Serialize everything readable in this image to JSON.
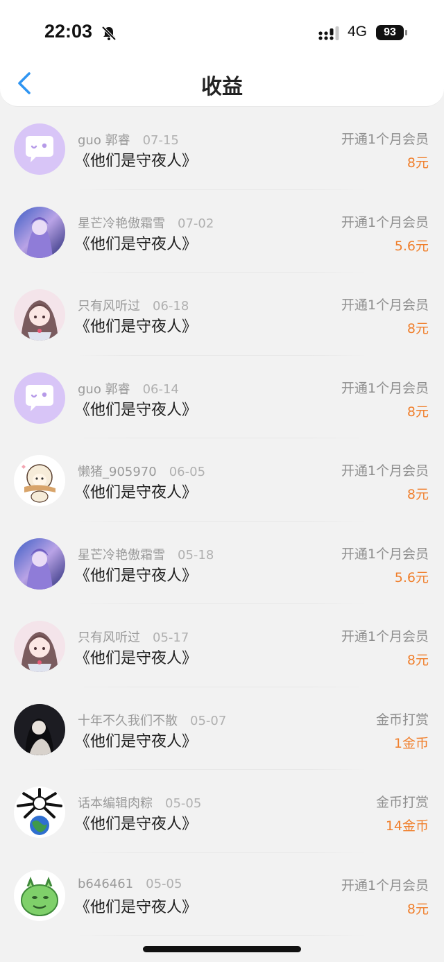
{
  "status_bar": {
    "time": "22:03",
    "network": "4G",
    "battery": "93"
  },
  "header": {
    "title": "收益",
    "back_icon": "chevron-left-icon",
    "accent": "#2f95f2"
  },
  "colors": {
    "amount": "#f07f2c",
    "background": "#f2f2f2"
  },
  "items": [
    {
      "user": "guo 郭睿",
      "date": "07-15",
      "work": "《他们是守夜人》",
      "type": "开通1个月会员",
      "amount": "8元",
      "avatar": "chat-bubble"
    },
    {
      "user": "星芒冷艳傲霜雪",
      "date": "07-02",
      "work": "《他们是守夜人》",
      "type": "开通1个月会员",
      "amount": "5.6元",
      "avatar": "anime-purple"
    },
    {
      "user": "只有风听过",
      "date": "06-18",
      "work": "《他们是守夜人》",
      "type": "开通1个月会员",
      "amount": "8元",
      "avatar": "anime-pink"
    },
    {
      "user": "guo 郭睿",
      "date": "06-14",
      "work": "《他们是守夜人》",
      "type": "开通1个月会员",
      "amount": "8元",
      "avatar": "chat-bubble"
    },
    {
      "user": "懒猪_905970",
      "date": "06-05",
      "work": "《他们是守夜人》",
      "type": "开通1个月会员",
      "amount": "8元",
      "avatar": "sheep"
    },
    {
      "user": "星芒冷艳傲霜雪",
      "date": "05-18",
      "work": "《他们是守夜人》",
      "type": "开通1个月会员",
      "amount": "5.6元",
      "avatar": "anime-purple"
    },
    {
      "user": "只有风听过",
      "date": "05-17",
      "work": "《他们是守夜人》",
      "type": "开通1个月会员",
      "amount": "8元",
      "avatar": "anime-pink"
    },
    {
      "user": "十年不久我们不散",
      "date": "05-07",
      "work": "《他们是守夜人》",
      "type": "金币打赏",
      "amount": "1金币",
      "avatar": "dark-girl"
    },
    {
      "user": "话本编辑肉粽",
      "date": "05-05",
      "work": "《他们是守夜人》",
      "type": "金币打赏",
      "amount": "14金币",
      "avatar": "spiky-earth"
    },
    {
      "user": "b646461",
      "date": "05-05",
      "work": "《他们是守夜人》",
      "type": "开通1个月会员",
      "amount": "8元",
      "avatar": "green-dragon"
    }
  ]
}
